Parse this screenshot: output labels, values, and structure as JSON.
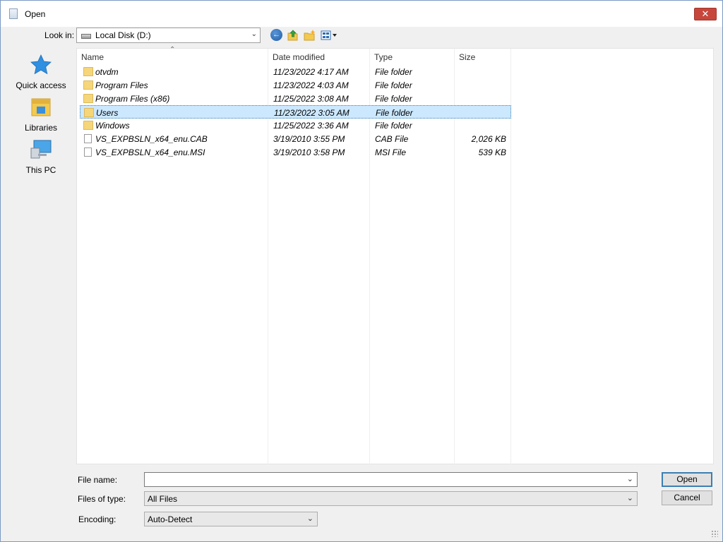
{
  "window": {
    "title": "Open",
    "close_label": "✕"
  },
  "toolbar": {
    "look_in_label": "Look in:",
    "look_in_value": "Local Disk (D:)",
    "icons": [
      "back-icon",
      "up-folder-icon",
      "new-folder-icon",
      "view-menu-icon"
    ]
  },
  "places": [
    {
      "label": "Quick access",
      "icon": "star-icon"
    },
    {
      "label": "Libraries",
      "icon": "libraries-icon"
    },
    {
      "label": "This PC",
      "icon": "computer-icon"
    }
  ],
  "columns": {
    "name": "Name",
    "date": "Date modified",
    "type": "Type",
    "size": "Size"
  },
  "files": [
    {
      "name": "otvdm",
      "date": "11/23/2022 4:17 AM",
      "type": "File folder",
      "size": "",
      "kind": "folder"
    },
    {
      "name": "Program Files",
      "date": "11/23/2022 4:03 AM",
      "type": "File folder",
      "size": "",
      "kind": "folder"
    },
    {
      "name": "Program Files (x86)",
      "date": "11/25/2022 3:08 AM",
      "type": "File folder",
      "size": "",
      "kind": "folder"
    },
    {
      "name": "Users",
      "date": "11/23/2022 3:05 AM",
      "type": "File folder",
      "size": "",
      "kind": "folder",
      "selected": true
    },
    {
      "name": "Windows",
      "date": "11/25/2022 3:36 AM",
      "type": "File folder",
      "size": "",
      "kind": "folder"
    },
    {
      "name": "VS_EXPBSLN_x64_enu.CAB",
      "date": "3/19/2010 3:55 PM",
      "type": "CAB File",
      "size": "2,026 KB",
      "kind": "file"
    },
    {
      "name": "VS_EXPBSLN_x64_enu.MSI",
      "date": "3/19/2010 3:58 PM",
      "type": "MSI File",
      "size": "539 KB",
      "kind": "file"
    }
  ],
  "form": {
    "file_name_label": "File name:",
    "file_name_value": "",
    "files_of_type_label": "Files of type:",
    "files_of_type_value": "All Files",
    "encoding_label": "Encoding:",
    "encoding_value": "Auto-Detect"
  },
  "buttons": {
    "open": "Open",
    "cancel": "Cancel"
  },
  "colors": {
    "selection": "#cce8ff",
    "accent": "#3c7fb1",
    "close": "#c7463c"
  }
}
